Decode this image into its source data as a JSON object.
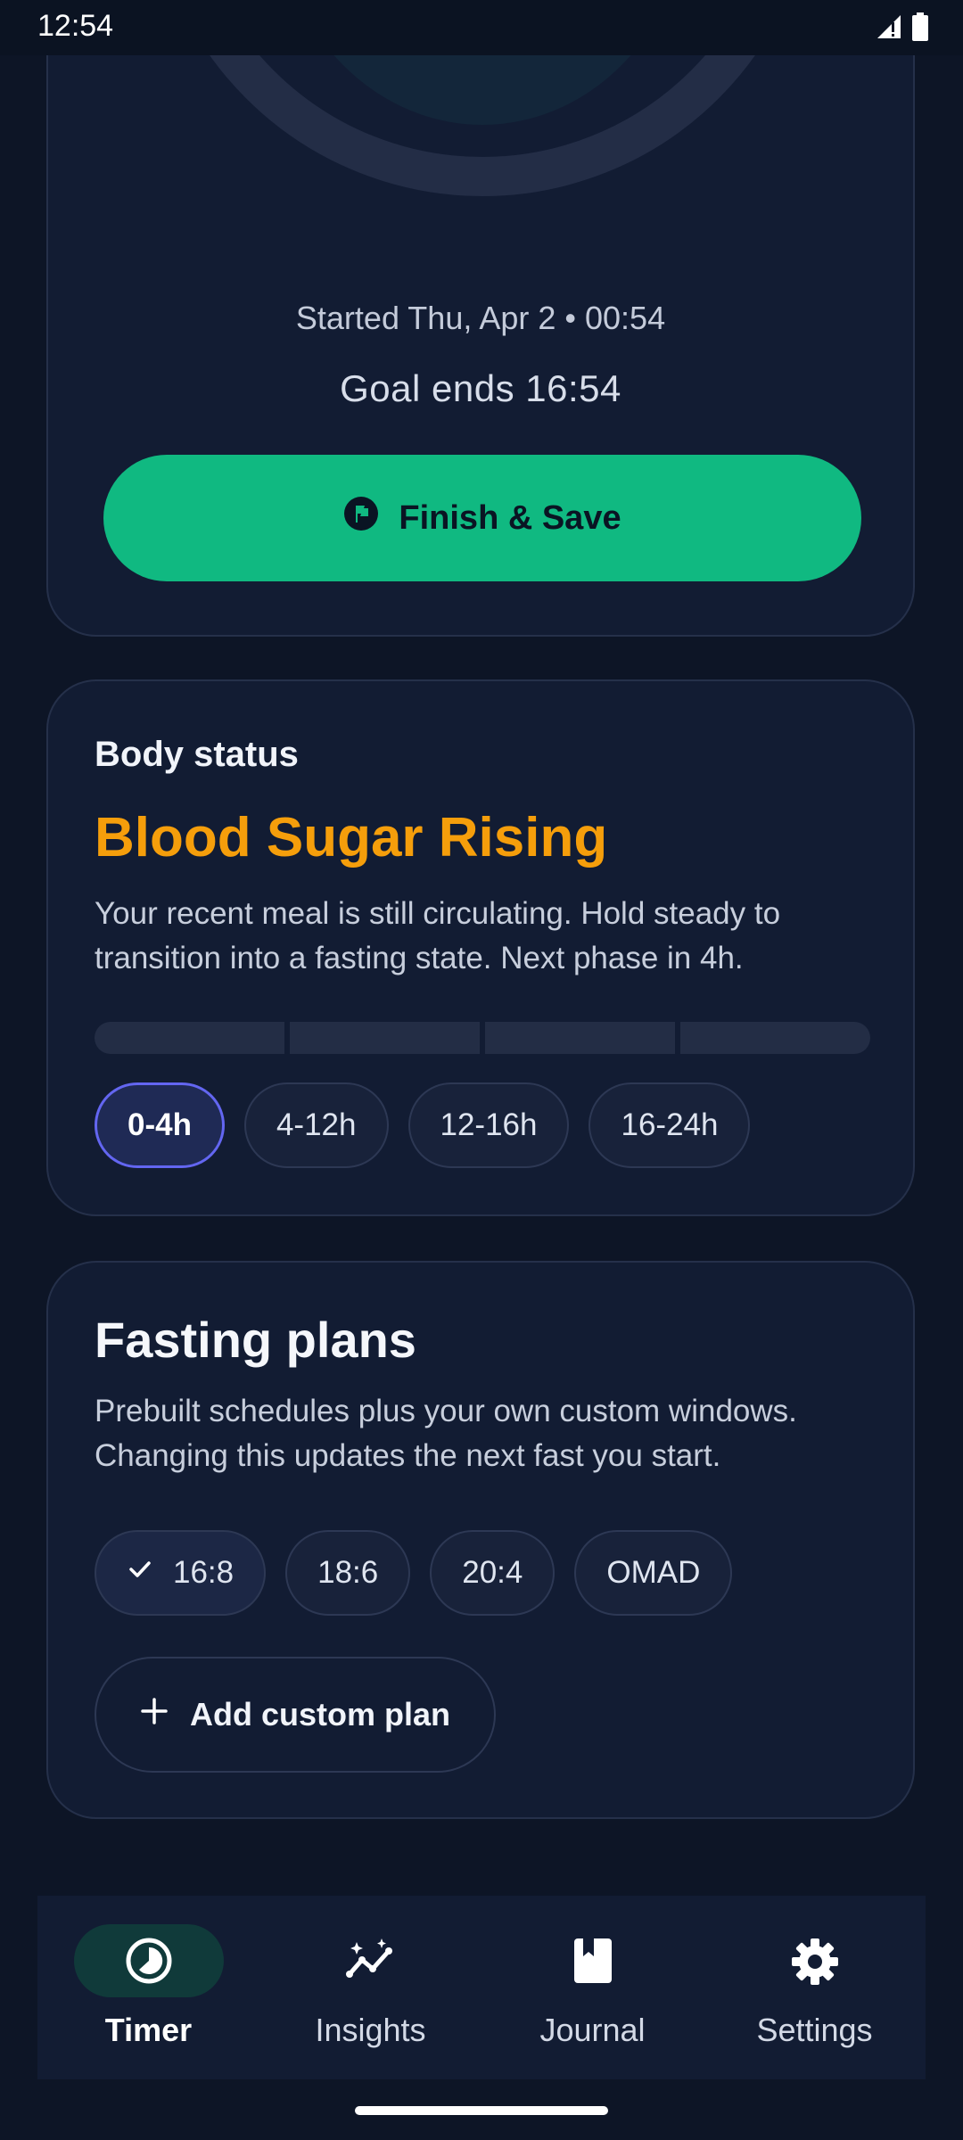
{
  "status_bar": {
    "time": "12:54"
  },
  "timer": {
    "started_text": "Started Thu, Apr 2 • 00:54",
    "goal_text": "Goal ends 16:54",
    "finish_label": "Finish & Save"
  },
  "body_status": {
    "label": "Body status",
    "phase_title": "Blood Sugar Rising",
    "description": "Your recent meal is still circulating. Hold steady to transition into a fasting state. Next phase in 4h.",
    "phase_progress": 0,
    "phases": [
      {
        "label": "0-4h",
        "active": true
      },
      {
        "label": "4-12h"
      },
      {
        "label": "12-16h"
      },
      {
        "label": "16-24h"
      }
    ]
  },
  "fasting_plans": {
    "title": "Fasting plans",
    "description": "Prebuilt schedules plus your own custom windows. Changing this updates the next fast you start.",
    "plans": [
      {
        "label": "16:8",
        "selected": true
      },
      {
        "label": "18:6"
      },
      {
        "label": "20:4"
      },
      {
        "label": "OMAD"
      }
    ],
    "add_label": "Add custom plan"
  },
  "nav": {
    "items": [
      {
        "label": "Timer",
        "icon": "timer-icon",
        "active": true
      },
      {
        "label": "Insights",
        "icon": "insights-icon"
      },
      {
        "label": "Journal",
        "icon": "journal-icon"
      },
      {
        "label": "Settings",
        "icon": "settings-icon"
      }
    ]
  },
  "colors": {
    "background": "#0d1526",
    "card": "#121c33",
    "accent_green": "#10b981",
    "phase_orange": "#f59e0b",
    "active_chip_border": "#6366f1"
  }
}
